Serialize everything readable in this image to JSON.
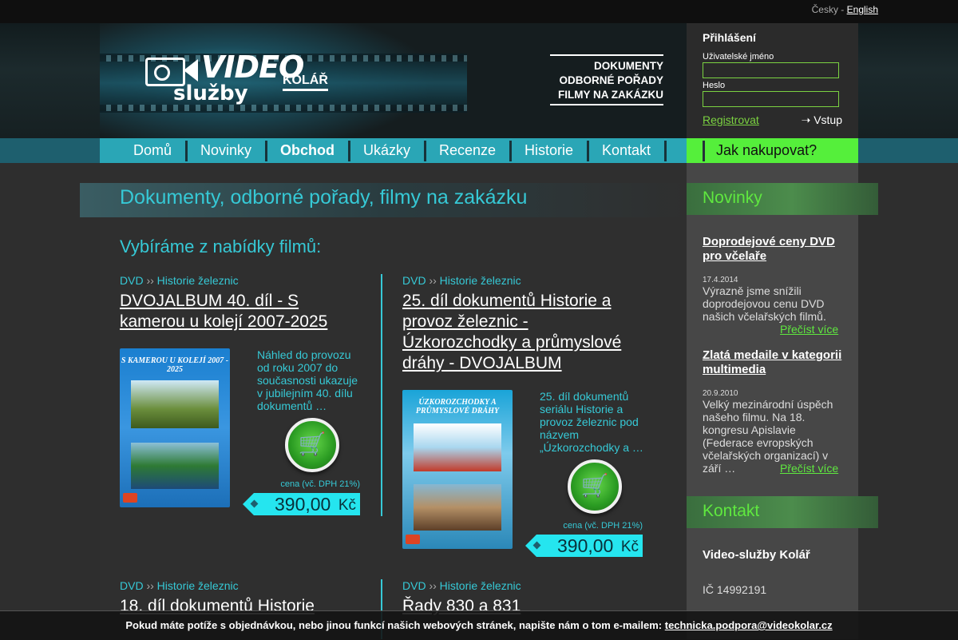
{
  "lang": {
    "cz": "Česky",
    "sep": " - ",
    "en": "English"
  },
  "logo": {
    "video": "VIDEO",
    "sluzby": "služby",
    "kolar": "KOLÁŘ"
  },
  "tagline": [
    "DOKUMENTY",
    "ODBORNÉ POŘADY",
    "FILMY NA ZAKÁZKU"
  ],
  "login": {
    "title": "Přihlášení",
    "user_label": "Uživatelské jméno",
    "user_value": "",
    "pass_label": "Heslo",
    "pass_value": "",
    "register": "Registrovat",
    "submit": "➝ Vstup"
  },
  "nav": {
    "items": [
      "Domů",
      "Novinky",
      "Obchod",
      "Ukázky",
      "Recenze",
      "Historie",
      "Kontakt"
    ],
    "active": "Obchod",
    "how_to_buy": "Jak nakupovat?"
  },
  "page_title": "Dokumenty, odborné pořady, filmy na zakázku",
  "subhead": "Vybíráme z nabídky filmů:",
  "products": [
    {
      "type": "DVD",
      "sep": " ›› ",
      "category": "Historie železnic",
      "title": "DVOJALBUM 40. díl - S kamerou u kolejí 2007-2025",
      "cover_title": "S KAMEROU U KOLEJÍ 2007 - 2025",
      "desc": "Náhled do provozu od roku 2007 do současnosti ukazuje v jubilejním 40. dílu dokumentů …",
      "vat": "cena (vč. DPH 21%)",
      "price": "390,00",
      "currency": "Kč"
    },
    {
      "type": "DVD",
      "sep": " ›› ",
      "category": "Historie železnic",
      "title": "25. díl dokumentů Historie a provoz železnic - Úzkorozchodky a průmyslové dráhy - DVOJALBUM",
      "cover_title": "ÚZKOROZCHODKY A PRŮMYSLOVÉ DRÁHY",
      "desc": "25. díl dokumentů seriálu Historie a provoz železnic pod názvem „Úzkorozchodky a …",
      "vat": "cena (vč. DPH 21%)",
      "price": "390,00",
      "currency": "Kč"
    },
    {
      "type": "DVD",
      "sep": " ›› ",
      "category": "Historie železnic",
      "title": "18. díl dokumentů Historie"
    },
    {
      "type": "DVD",
      "sep": " ›› ",
      "category": "Historie železnic",
      "title": "Řady 830 a 831"
    }
  ],
  "sidebar": {
    "news_title": "Novinky",
    "news": [
      {
        "title": "Doprodejové ceny DVD pro včelaře",
        "date": "17.4.2014",
        "text": "Výrazně jsme snížili doprodejovou cenu DVD našich včelařských filmů.",
        "more": "Přečíst více"
      },
      {
        "title": "Zlatá medaile v kategorii multimedia",
        "date": "20.9.2010",
        "text": "Velký mezinárodní úspěch našeho filmu. Na 18. kongresu Apislavie (Federace evropských včelařských organizací) v září …",
        "more": "Přečíst více"
      }
    ],
    "contact_title": "Kontakt",
    "contact_name": "Video-služby Kolář",
    "contact_ic": "IČ 14992191"
  },
  "notice": {
    "text": "Pokud máte potíže s objednávkou, nebo jinou funkcí našich webových stránek, napište nám o tom e-mailem: ",
    "email": "technicka.podpora@videokolar.cz"
  },
  "colors": {
    "accent_cyan": "#36c9d6",
    "accent_green": "#5fe83f",
    "price_bg": "#25e5ef"
  }
}
